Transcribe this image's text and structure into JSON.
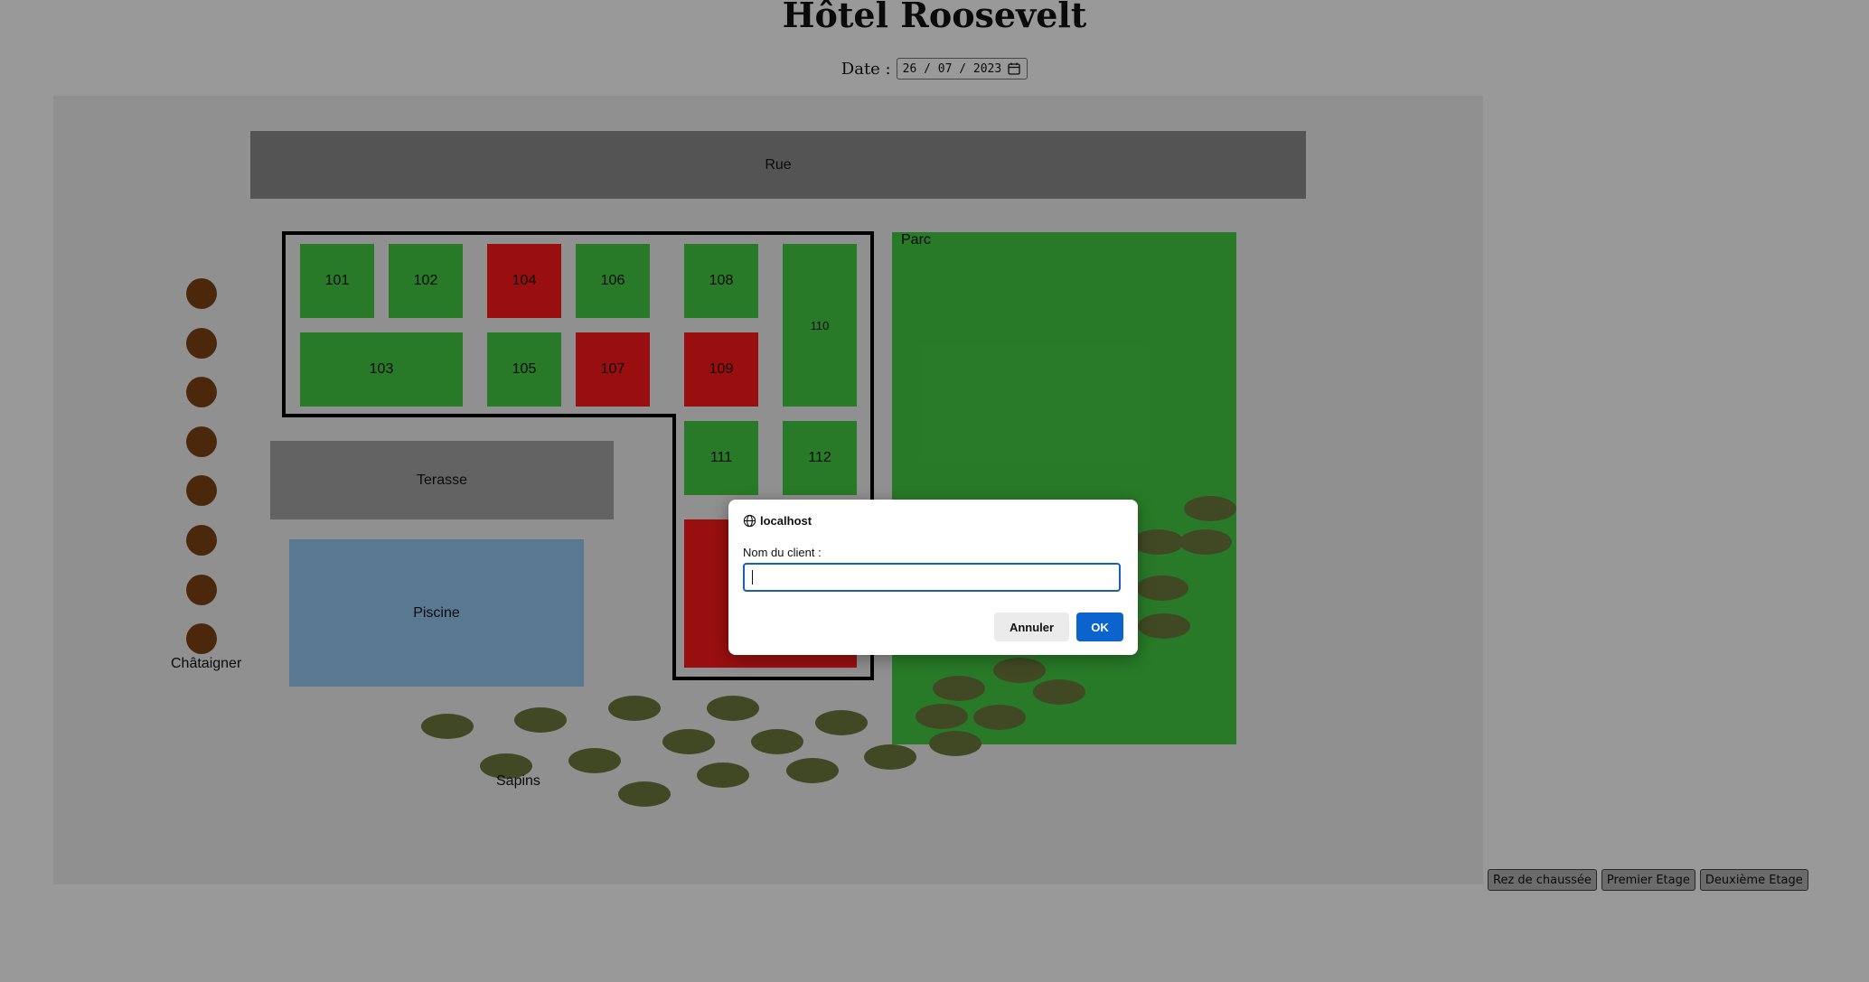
{
  "page": {
    "title": "Hôtel Roosevelt",
    "date_label": "Date :",
    "date_value": "26 / 07 / 2023"
  },
  "map": {
    "street_label": "Rue",
    "park_label": "Parc",
    "terrace_label": "Terasse",
    "pool_label": "Piscine",
    "chestnut_label": "Châtaigner",
    "fir_label": "Sapins",
    "rooms": [
      {
        "number": "101",
        "status": "free"
      },
      {
        "number": "102",
        "status": "free"
      },
      {
        "number": "104",
        "status": "busy"
      },
      {
        "number": "106",
        "status": "free"
      },
      {
        "number": "108",
        "status": "free"
      },
      {
        "number": "110",
        "status": "free"
      },
      {
        "number": "103",
        "status": "free"
      },
      {
        "number": "105",
        "status": "free"
      },
      {
        "number": "107",
        "status": "busy"
      },
      {
        "number": "109",
        "status": "busy"
      },
      {
        "number": "111",
        "status": "free"
      },
      {
        "number": "112",
        "status": "free"
      },
      {
        "number": "",
        "status": "busy"
      }
    ],
    "colors": {
      "free": "#44cc44",
      "busy": "#ff1a1a",
      "street": "#8d8d8e",
      "pool": "#94caf5",
      "chestnut": "#7d4414",
      "fir": "#6d7b3d"
    }
  },
  "floor_buttons": {
    "ground": "Rez de chaussée",
    "first": "Premier Etage",
    "second": "Deuxième Etage"
  },
  "dialog": {
    "origin": "localhost",
    "origin_icon": "globe-icon",
    "message": "Nom du client :",
    "input_value": "",
    "cancel_label": "Annuler",
    "ok_label": "OK"
  }
}
